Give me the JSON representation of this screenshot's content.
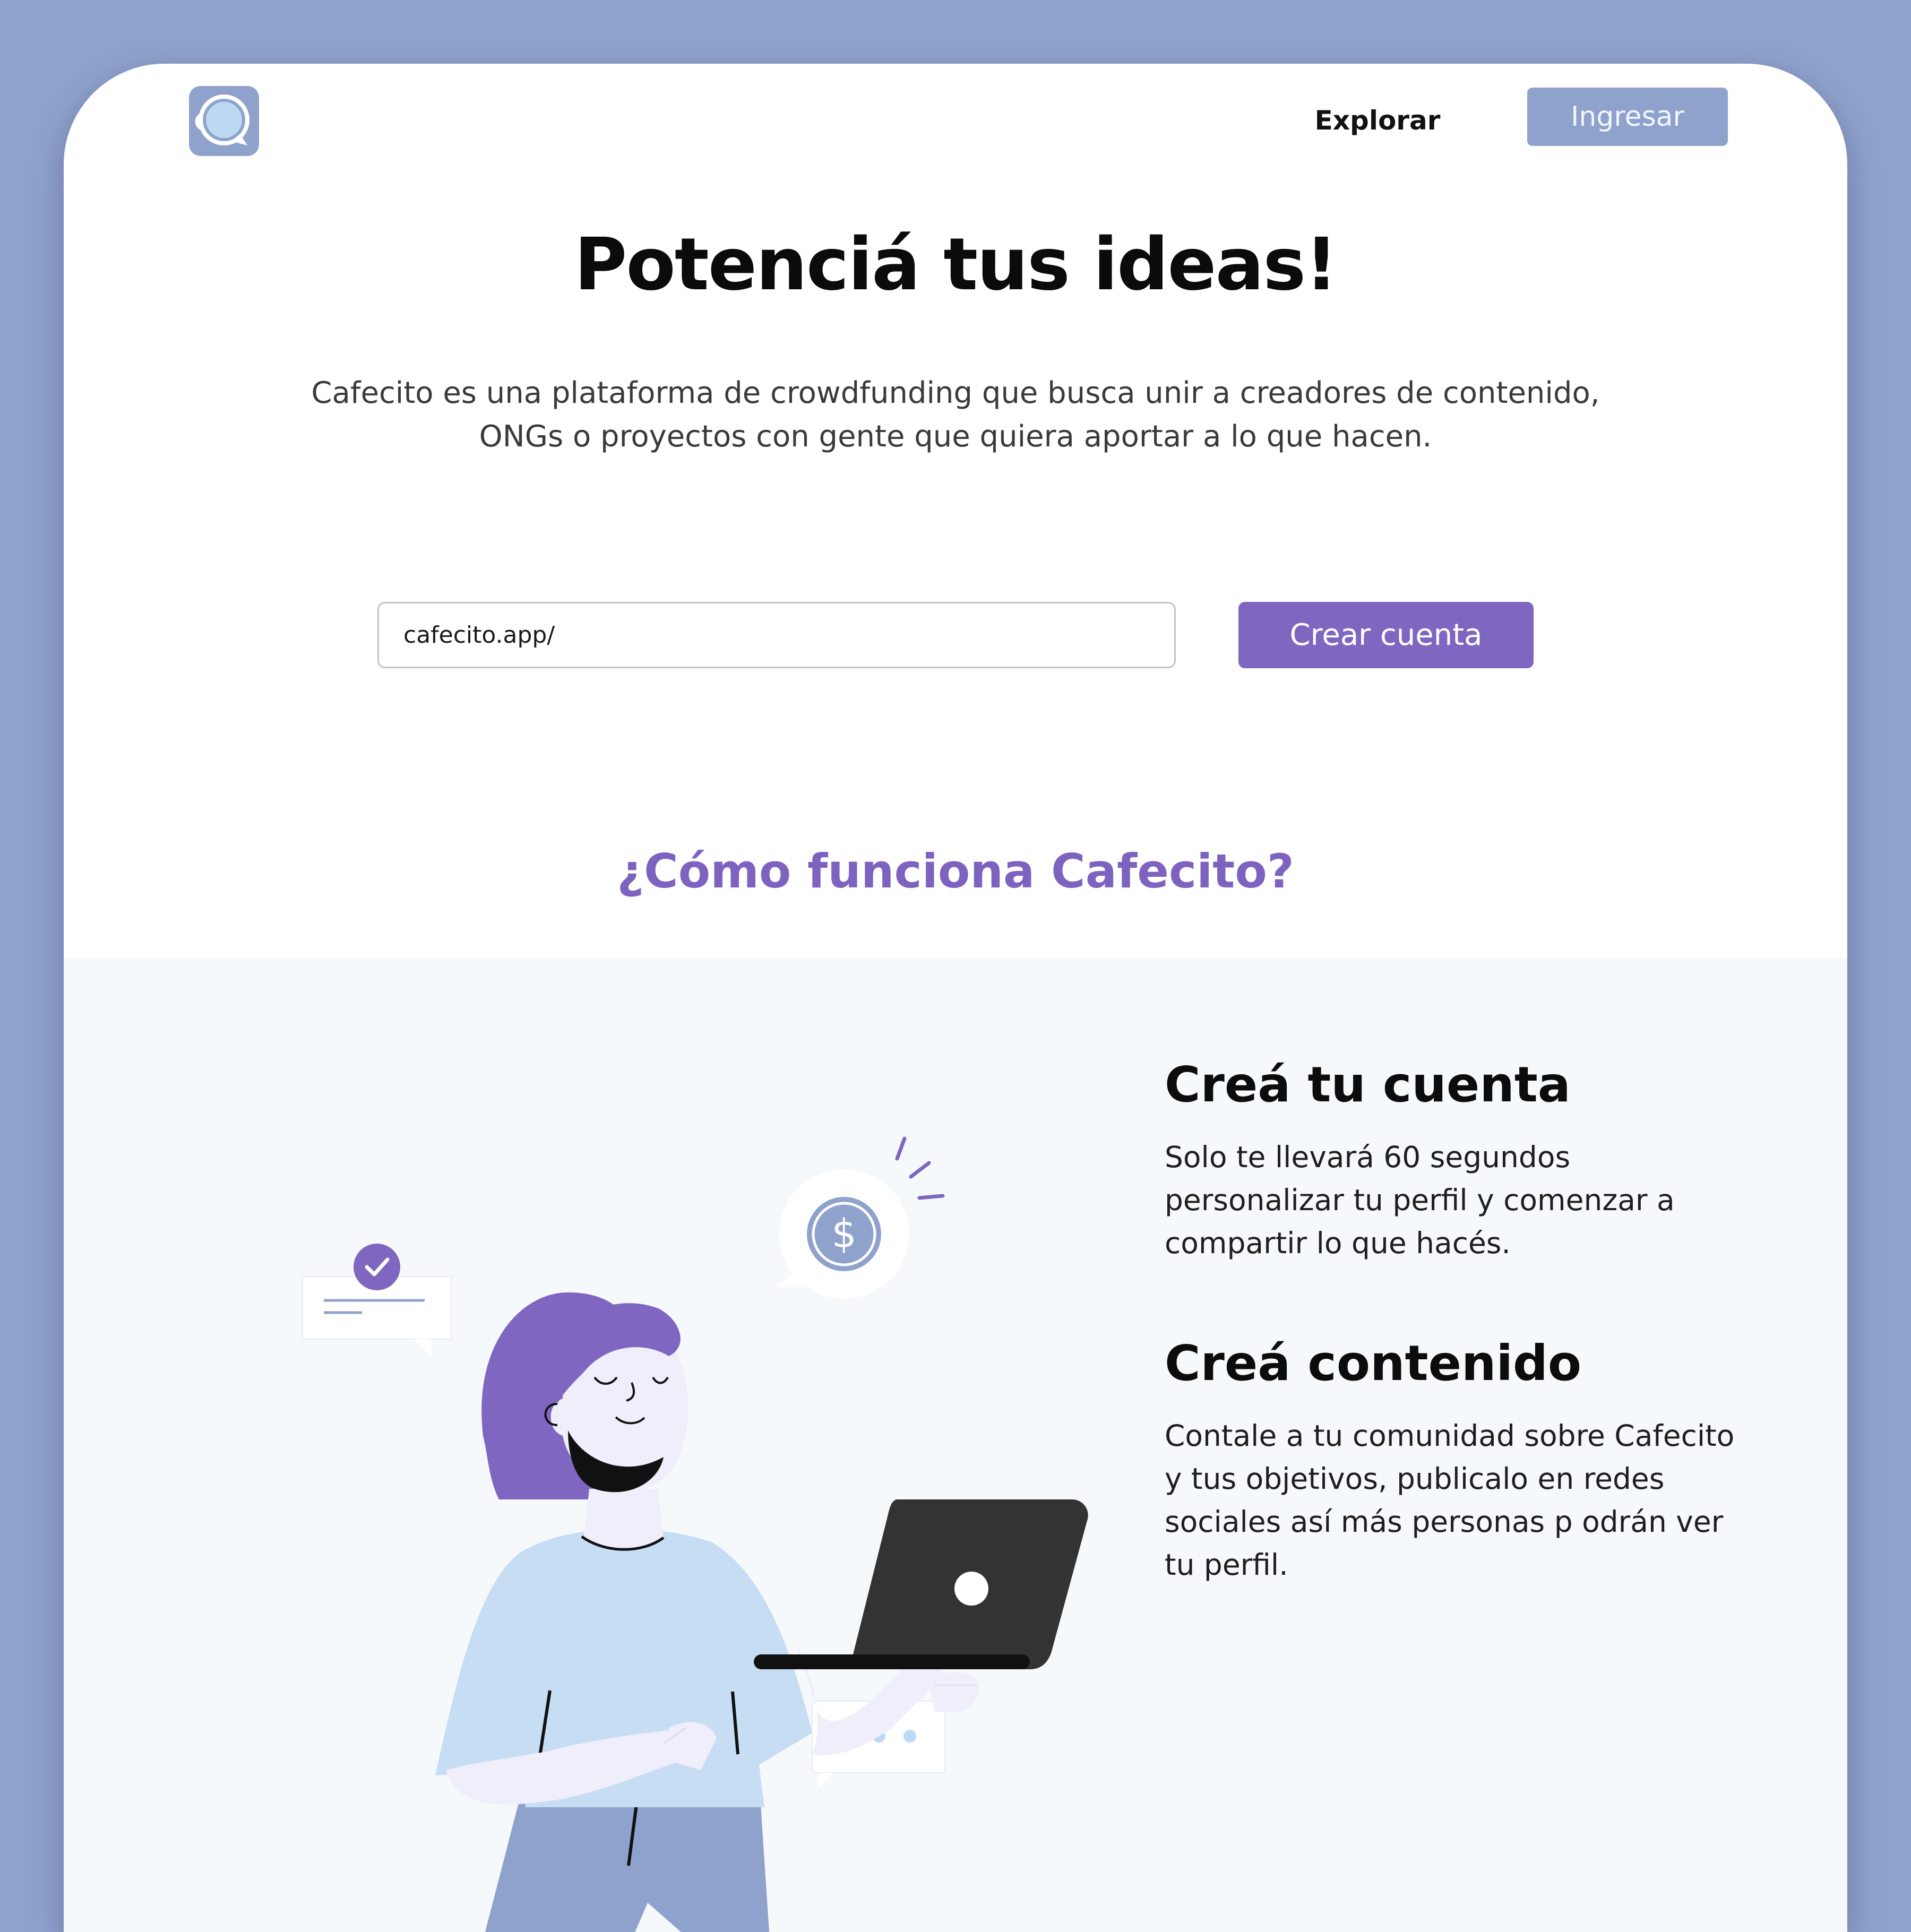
{
  "header": {
    "logo": "cafecito-cup-logo-icon",
    "nav_explore": "Explorar",
    "login_label": "Ingresar"
  },
  "hero": {
    "title": "Potenciá tus ideas!",
    "description": "Cafecito es una plataforma de crowdfunding que busca unir a creadores de contenido, ONGs o proyectos con gente que quiera aportar a lo que hacen."
  },
  "signup": {
    "url_value": "cafecito.app/",
    "create_label": "Crear cuenta"
  },
  "how": {
    "title": "¿Cómo funciona Cafecito?",
    "steps": [
      {
        "title": "Creá tu cuenta",
        "text": "Solo te llevará 60 segundos personalizar tu perfil y comenzar a compartir lo que hacés."
      },
      {
        "title": "Creá contenido",
        "text": "Contale a tu comunidad sobre Cafecito y tus objetivos, publicalo en redes sociales así más personas p odrán ver tu perfil."
      }
    ]
  },
  "colors": {
    "page_bg": "#8fa2cc",
    "accent_purple": "#7e66c1",
    "login_button": "#8fa2cc",
    "section_bg": "#f6f9fc"
  },
  "icons": [
    "cafecito-cup-logo-icon",
    "check-icon",
    "dollar-coin-icon",
    "laptop-icon",
    "typing-dots-icon"
  ]
}
